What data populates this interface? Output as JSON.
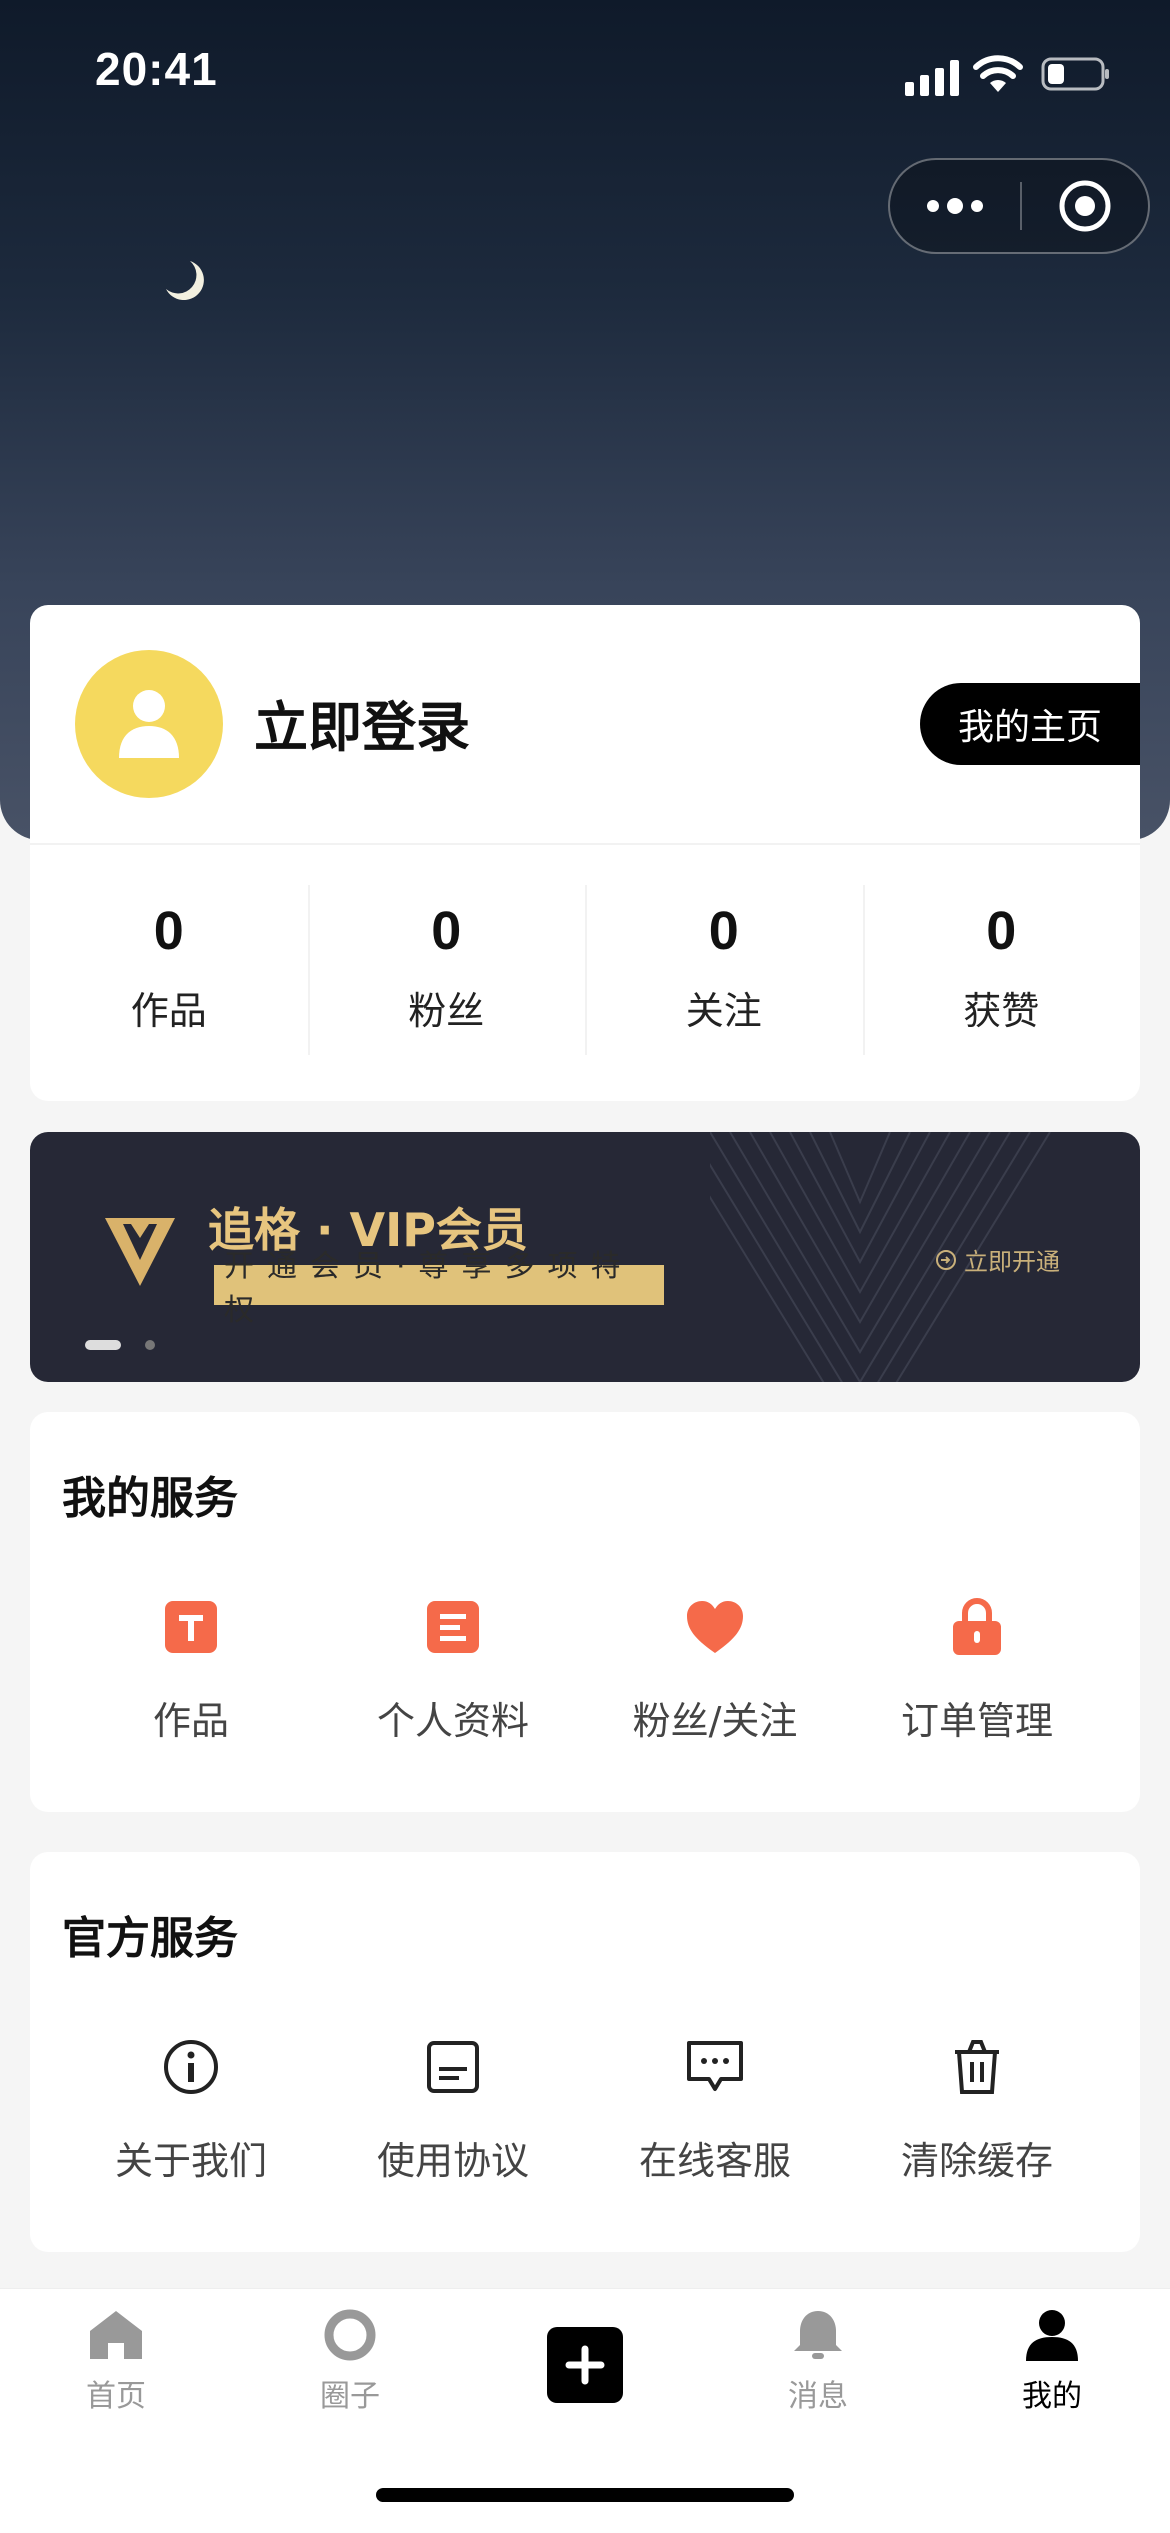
{
  "status_bar": {
    "time": "20:41"
  },
  "profile": {
    "login_text": "立即登录",
    "homepage_button": "我的主页",
    "stats": [
      {
        "value": "0",
        "label": "作品"
      },
      {
        "value": "0",
        "label": "粉丝"
      },
      {
        "value": "0",
        "label": "关注"
      },
      {
        "value": "0",
        "label": "获赞"
      }
    ]
  },
  "vip": {
    "title": "追格 · VIP会员",
    "subtitle": "开通会员·尊享多项特权",
    "action": "立即开通",
    "accent_color": "#e7c57f"
  },
  "my_services": {
    "title": "我的服务",
    "items": [
      {
        "label": "作品",
        "icon": "text-t-icon"
      },
      {
        "label": "个人资料",
        "icon": "document-icon"
      },
      {
        "label": "粉丝/关注",
        "icon": "heart-icon"
      },
      {
        "label": "订单管理",
        "icon": "lock-icon"
      }
    ],
    "icon_color": "#f56a4a"
  },
  "official_services": {
    "title": "官方服务",
    "items": [
      {
        "label": "关于我们",
        "icon": "info-icon"
      },
      {
        "label": "使用协议",
        "icon": "agreement-icon"
      },
      {
        "label": "在线客服",
        "icon": "chat-icon"
      },
      {
        "label": "清除缓存",
        "icon": "trash-icon"
      }
    ]
  },
  "tabbar": {
    "tabs": [
      {
        "label": "首页",
        "icon": "home-icon"
      },
      {
        "label": "圈子",
        "icon": "circle-icon"
      },
      {
        "label": "",
        "icon": "plus-icon"
      },
      {
        "label": "消息",
        "icon": "bell-icon"
      },
      {
        "label": "我的",
        "icon": "user-icon",
        "active": true
      }
    ]
  }
}
